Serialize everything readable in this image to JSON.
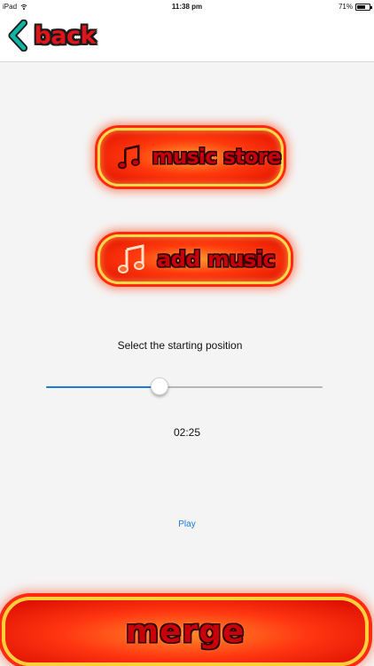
{
  "status_bar": {
    "device": "iPad",
    "time": "11:38 pm",
    "battery": "71%",
    "battery_level": 0.71
  },
  "nav": {
    "back_label": "back"
  },
  "buttons": {
    "music_store": "music store",
    "add_music": "add music",
    "merge": "merge"
  },
  "slider": {
    "caption": "Select the starting position",
    "value": 0.41,
    "time": "02:25"
  },
  "play_label": "Play",
  "colors": {
    "accent_blue": "#1b7bd6",
    "neon_red": "#e0141b",
    "back_chevron": "#0fb5a6"
  }
}
